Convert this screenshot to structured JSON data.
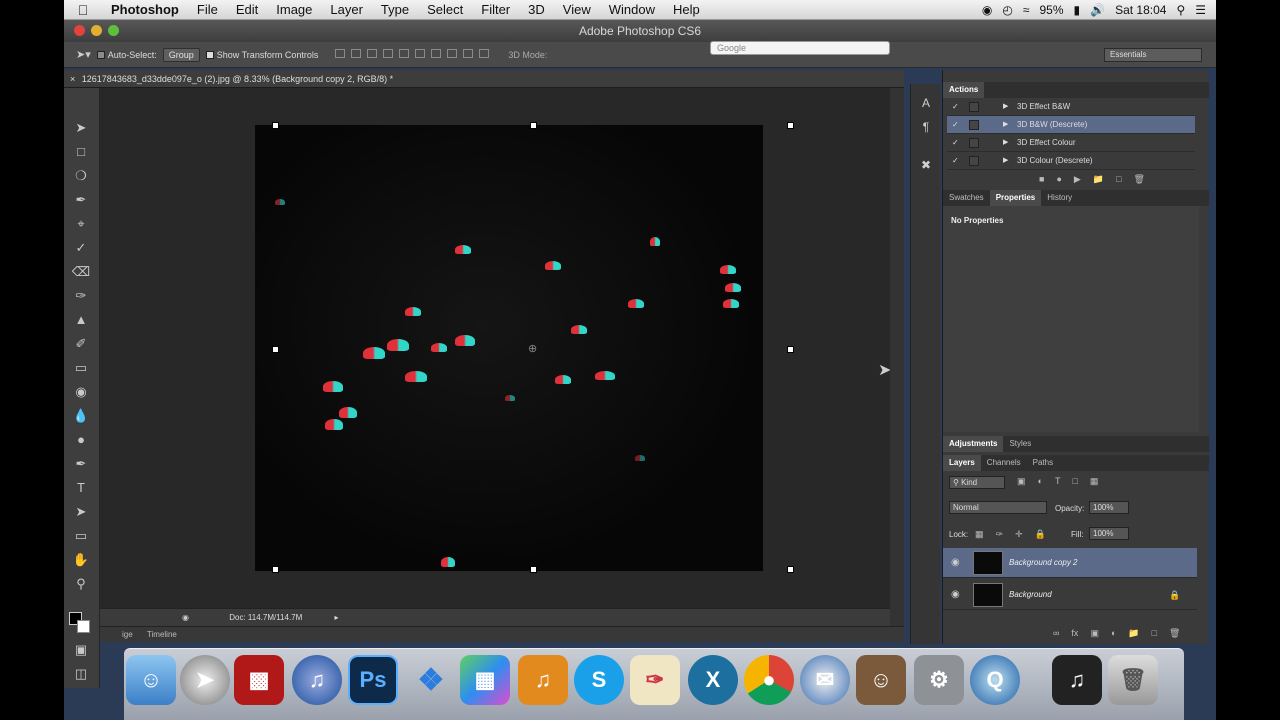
{
  "menubar": {
    "app_name": "Photoshop",
    "menus": [
      "File",
      "Edit",
      "Image",
      "Layer",
      "Type",
      "Select",
      "Filter",
      "3D",
      "View",
      "Window",
      "Help"
    ],
    "battery": "95%",
    "clock": "Sat 18:04"
  },
  "window": {
    "title": "Adobe Photoshop CS6"
  },
  "options_bar": {
    "auto_select_label": "Auto-Select:",
    "auto_select_value": "Group",
    "show_transform_label": "Show Transform Controls",
    "mode_3d_label": "3D Mode:",
    "workspace": "Essentials"
  },
  "browser_search": {
    "placeholder": "Google"
  },
  "document": {
    "tab_title": "12617843683_d33dde097e_o (2).jpg @ 8.33% (Background copy 2, RGB/8) *",
    "doc_size": "Doc: 114.7M/114.7M",
    "bottom_tab_left": "ige",
    "bottom_tab_timeline": "Timeline"
  },
  "panels": {
    "actions": {
      "tab": "Actions",
      "items": [
        {
          "name": "3D Effect B&W",
          "selected": false
        },
        {
          "name": "3D B&W (Descrete)",
          "selected": true
        },
        {
          "name": "3D Effect Colour",
          "selected": false
        },
        {
          "name": "3D Colour (Descrete)",
          "selected": false
        }
      ]
    },
    "properties": {
      "tabs": [
        "Swatches",
        "Properties",
        "History"
      ],
      "active": "Properties",
      "empty_text": "No Properties"
    },
    "adjustments": {
      "tabs": [
        "Adjustments",
        "Styles"
      ],
      "active": "Adjustments"
    },
    "layers": {
      "tabs": [
        "Layers",
        "Channels",
        "Paths"
      ],
      "active": "Layers",
      "kind": "Kind",
      "blend_mode": "Normal",
      "opacity_label": "Opacity:",
      "opacity": "100%",
      "lock_label": "Lock:",
      "fill_label": "Fill:",
      "fill": "100%",
      "items": [
        {
          "name": "Background copy 2",
          "selected": true,
          "locked": false
        },
        {
          "name": "Background",
          "selected": false,
          "locked": true
        }
      ]
    }
  },
  "dock_apps": [
    "Finder",
    "Launchpad",
    "Photo Booth",
    "iTunes",
    "Photoshop",
    "Dropbox",
    "Numbers",
    "GarageBand",
    "Skype",
    "Pages",
    "Excel",
    "Chrome",
    "Thunderbird",
    "Game",
    "System Preferences",
    "QuickTime",
    "Music",
    "Trash"
  ],
  "colors": {
    "accent_selected": "#5a6a88",
    "panel_bg": "#3a3a3a",
    "canvas_bg": "#282828"
  }
}
